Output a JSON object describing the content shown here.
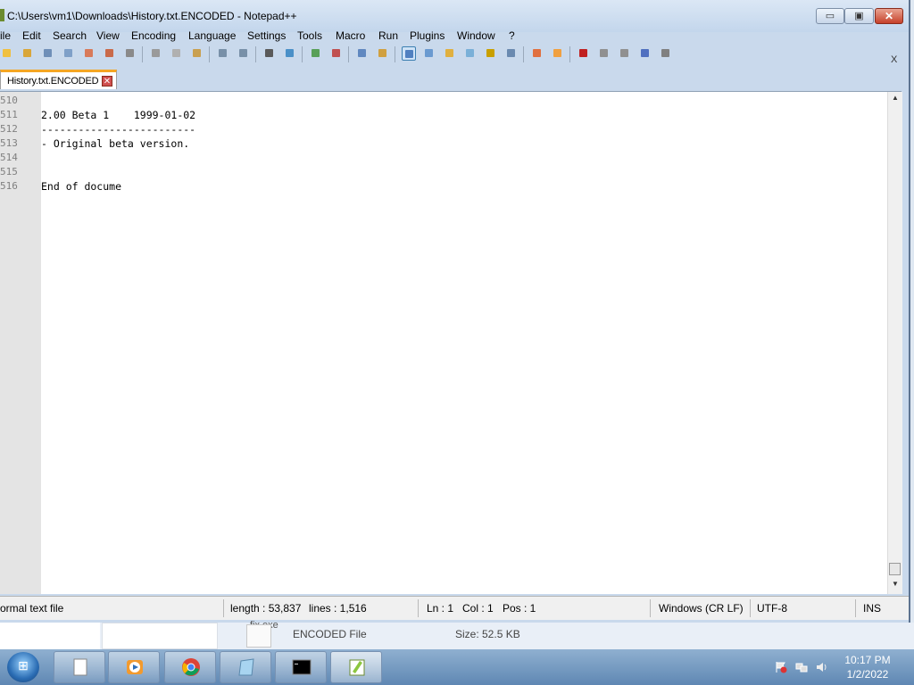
{
  "window": {
    "title": "C:\\Users\\vm1\\Downloads\\History.txt.ENCODED - Notepad++",
    "min_glyph": "▭",
    "max_glyph": "▣",
    "close_glyph": "✕",
    "menu_close_glyph": "X"
  },
  "menu": [
    "ile",
    "Edit",
    "Search",
    "View",
    "Encoding",
    "Language",
    "Settings",
    "Tools",
    "Macro",
    "Run",
    "Plugins",
    "Window",
    "?"
  ],
  "toolbar": {
    "icons": [
      "new-file-icon",
      "open-file-icon",
      "save-icon",
      "save-all-icon",
      "close-icon",
      "close-all-icon",
      "print-icon",
      "cut-icon",
      "copy-icon",
      "paste-icon",
      "undo-icon",
      "redo-icon",
      "find-icon",
      "replace-icon",
      "zoom-in-icon",
      "zoom-out-icon",
      "sync-vertical-icon",
      "sync-horizontal-icon",
      "word-wrap-icon",
      "show-all-chars-icon",
      "indent-guide-icon",
      "user-defined-lang-icon",
      "doc-map-icon",
      "function-list-icon",
      "folder-as-workspace-icon",
      "monitoring-icon",
      "record-macro-icon",
      "stop-record-icon",
      "play-macro-icon",
      "run-macro-multiple-icon",
      "save-macro-icon"
    ]
  },
  "tab": {
    "label": "History.txt.ENCODED",
    "close_glyph": "✕"
  },
  "editor": {
    "lines": [
      {
        "num": "510",
        "text": ""
      },
      {
        "num": "511",
        "text": "2.00 Beta 1    1999-01-02"
      },
      {
        "num": "512",
        "text": "-------------------------"
      },
      {
        "num": "513",
        "text": "- Original beta version."
      },
      {
        "num": "514",
        "text": ""
      },
      {
        "num": "515",
        "text": ""
      },
      {
        "num": "516",
        "text": "End of docume"
      }
    ],
    "scroll_up": "▲",
    "scroll_down": "▼"
  },
  "status": {
    "type": "ormal text file",
    "length": "length : 53,837",
    "lines": "lines : 1,516",
    "ln": "Ln : 1",
    "col": "Col : 1",
    "pos": "Pos : 1",
    "eol": "Windows (CR LF)",
    "encoding": "UTF-8",
    "mode": "INS"
  },
  "explorer": {
    "clipped_name": "fix.exe",
    "file_type": "ENCODED File",
    "size": "Size:  52.5 KB"
  },
  "taskbar": {
    "start_glyph": "⊞",
    "apps": [
      "file-explorer-icon",
      "media-player-icon",
      "chrome-icon",
      "notepad-icon",
      "cmd-icon",
      "notepad-plus-plus-icon"
    ],
    "time": "10:17 PM",
    "date": "1/2/2022"
  },
  "colors": {
    "accent_tab": "#f5a623",
    "gutter": "#e4e4e4",
    "taskbar": "#5f87b3"
  }
}
